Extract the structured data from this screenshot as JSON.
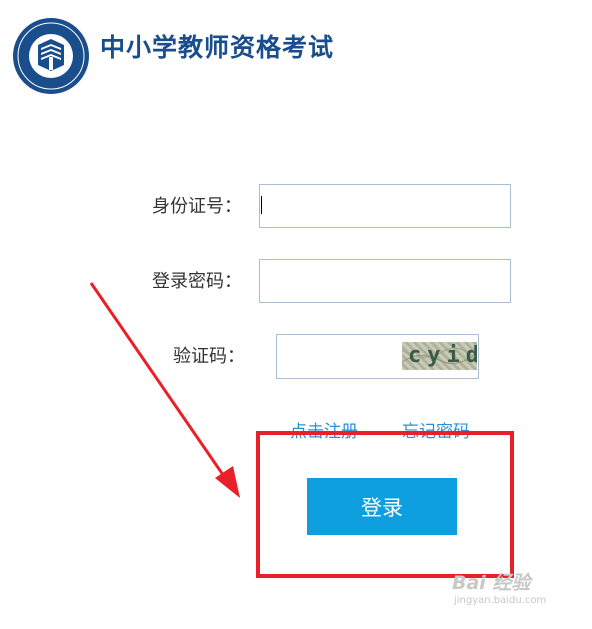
{
  "header": {
    "title": "中小学教师资格考试",
    "logo_icon": "teacher-certification-seal-icon"
  },
  "form": {
    "id_label": "身份证号：",
    "id_value": "",
    "password_label": "登录密码：",
    "password_value": "",
    "captcha_label": "验证码：",
    "captcha_value": "",
    "captcha_text": "cyid"
  },
  "links": {
    "register": "点击注册",
    "forgot_password": "忘记密码"
  },
  "login_button": "登录",
  "watermark": {
    "brand": "Bai 经验",
    "url": "jingyan.baidu.com"
  },
  "colors": {
    "title": "#1a4d8c",
    "link": "#2b8fd4",
    "button": "#0d9fe0",
    "annotation": "#e8202a"
  }
}
